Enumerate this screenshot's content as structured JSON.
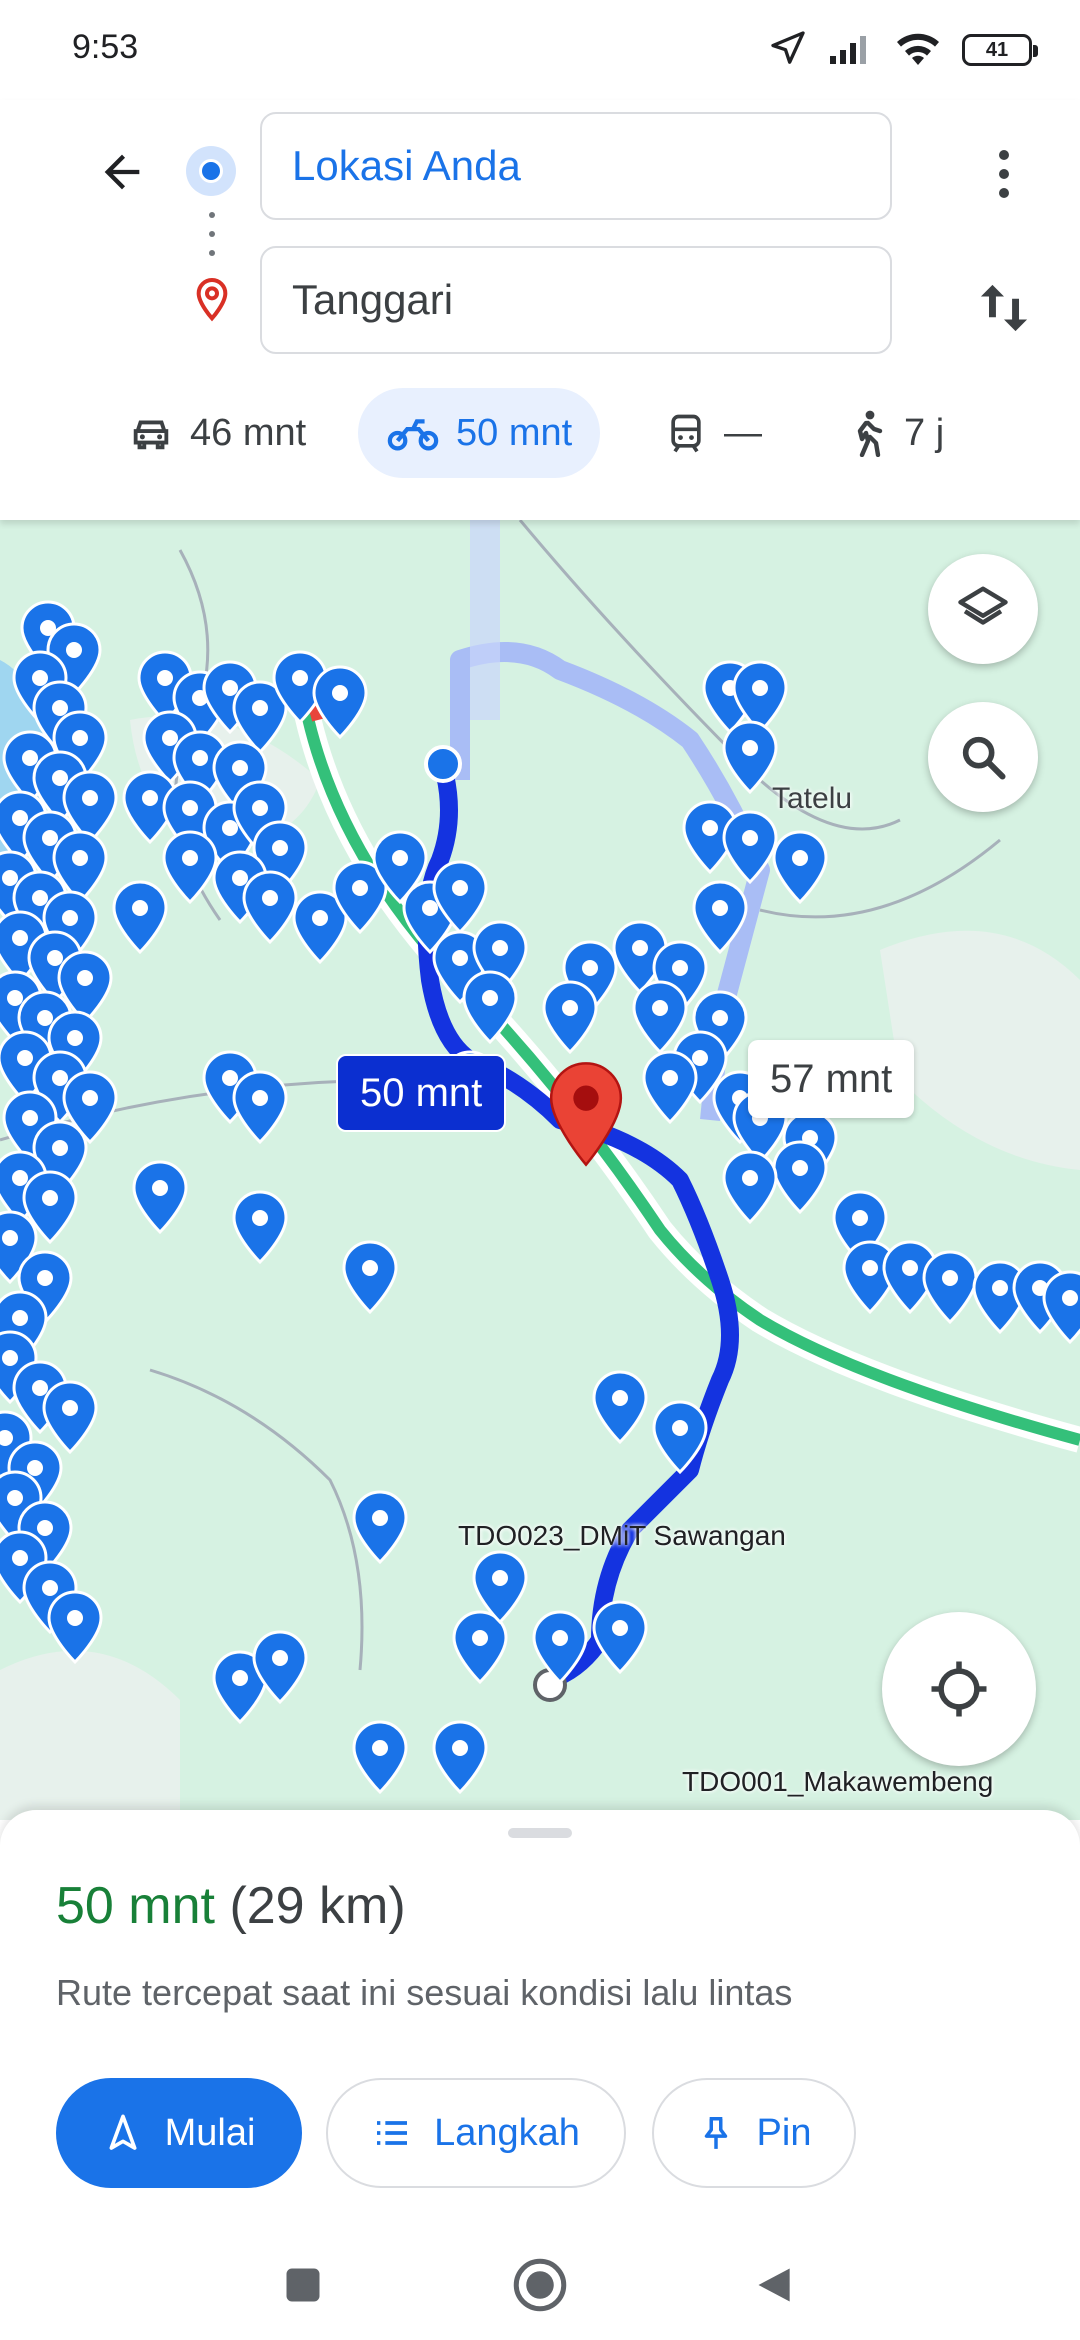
{
  "status_bar": {
    "time": "9:53",
    "battery": "41"
  },
  "directions": {
    "origin": "Lokasi Anda",
    "destination": "Tanggari"
  },
  "modes": [
    {
      "icon": "car-icon",
      "label": "46 mnt",
      "selected": false
    },
    {
      "icon": "motorcycle-icon",
      "label": "50 mnt",
      "selected": true
    },
    {
      "icon": "transit-icon",
      "label": "—",
      "selected": false
    },
    {
      "icon": "walk-icon",
      "label": "7 j",
      "selected": false
    }
  ],
  "map": {
    "labels": {
      "tatelu": "Tatelu",
      "sawangan": "TDO023_DMiT Sawangan",
      "makawembeng": "TDO001_Makawembeng"
    },
    "route_bubble_primary": "50 mnt",
    "route_bubble_alt": "57 mnt"
  },
  "sheet": {
    "duration": "50 mnt",
    "distance": "(29 km)",
    "subtitle": "Rute tercepat saat ini sesuai kondisi lalu lintas",
    "start_label": "Mulai",
    "steps_label": "Langkah",
    "pin_label": "Pin"
  },
  "colors": {
    "accent": "#1a73e8",
    "route": "#1433e0",
    "duration_green": "#188038",
    "map_bg": "#d6f2e2"
  }
}
